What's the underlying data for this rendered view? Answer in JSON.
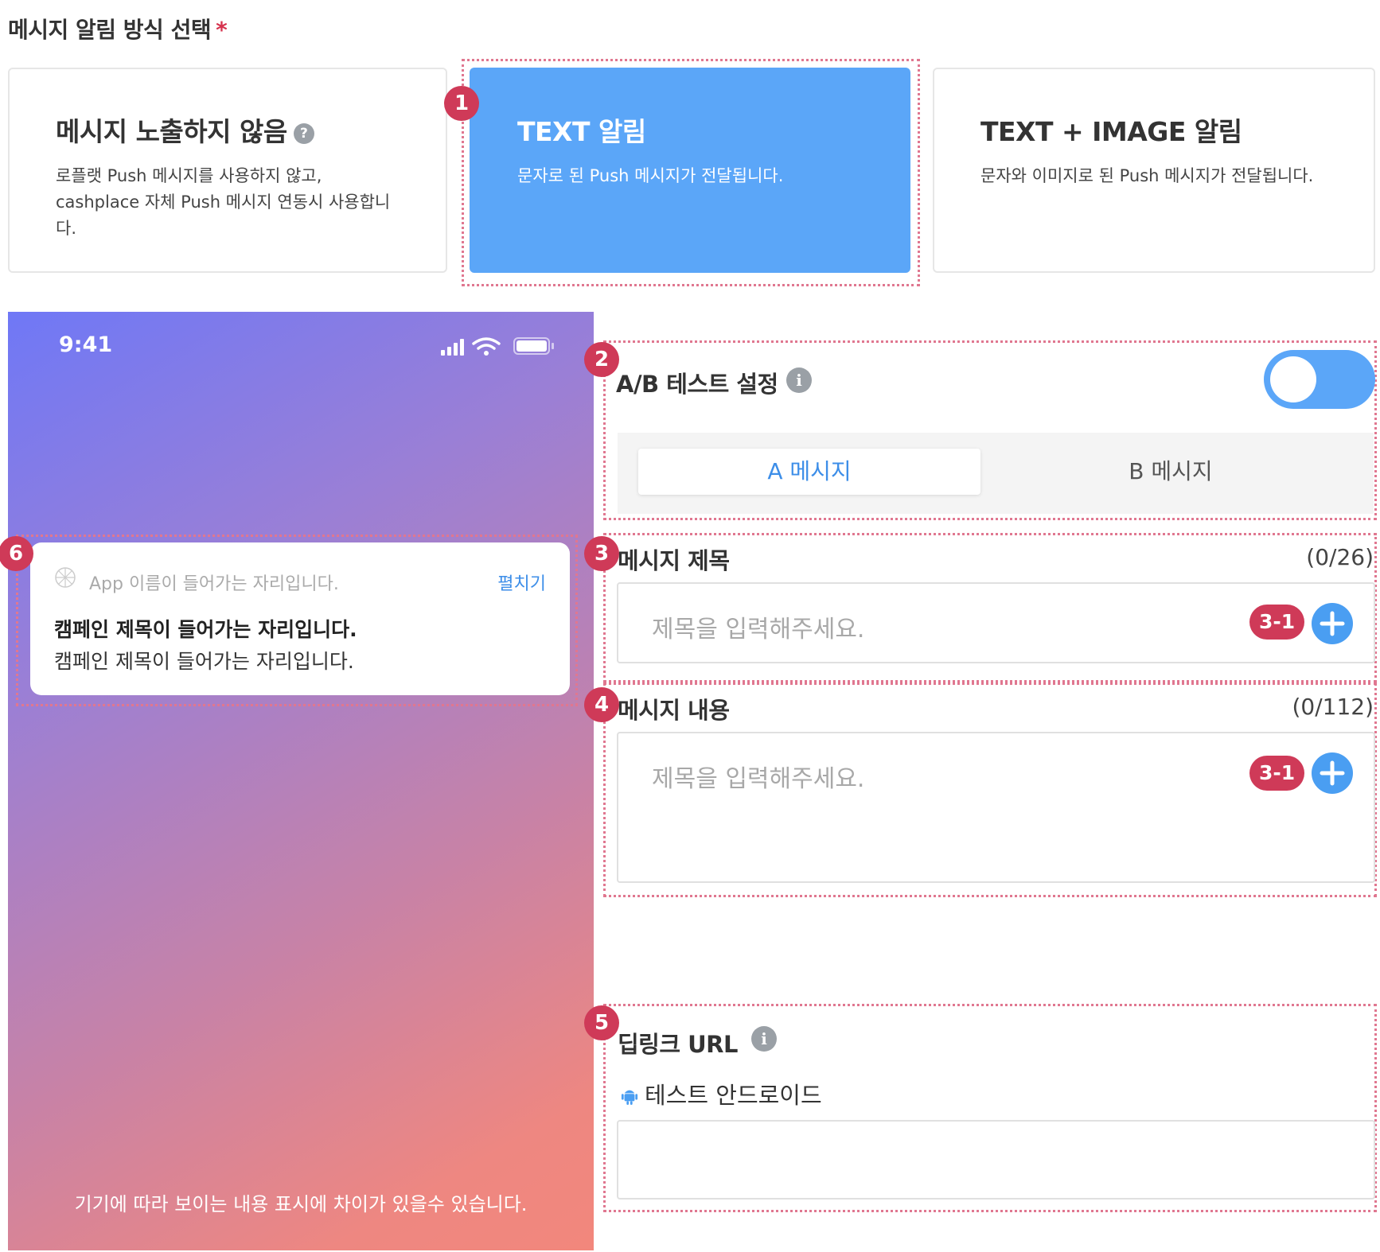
{
  "header": {
    "title": "메시지 알림 방식 선택",
    "required_mark": "*"
  },
  "cards": [
    {
      "title": "메시지 노출하지 않음",
      "help": "?",
      "desc": "로플랫 Push 메시지를 사용하지 않고, cashplace 자체 Push 메시지 연동시 사용합니다."
    },
    {
      "title": "TEXT 알림",
      "desc": "문자로 된 Push 메시지가 전달됩니다.",
      "selected": true
    },
    {
      "title": "TEXT + IMAGE 알림",
      "desc": "문자와 이미지로 된 Push 메시지가 전달됩니다."
    }
  ],
  "badges": {
    "b1": "1",
    "b2": "2",
    "b3": "3",
    "b4": "4",
    "b5": "5",
    "b6": "6",
    "b31": "3-1"
  },
  "phone": {
    "time": "9:41",
    "notification": {
      "app_name": "App 이름이 들어가는 자리입니다.",
      "expand": "펼치기",
      "title": "캠페인 제목이 들어가는 자리입니다.",
      "body": "캠페인 제목이 들어가는 자리입니다."
    },
    "footer": "기기에 따라 보이는 내용 표시에 차이가 있을수 있습니다."
  },
  "ab_test": {
    "label": "A/B 테스트 설정",
    "info": "i",
    "enabled": true,
    "tabs": [
      "A 메시지",
      "B 메시지"
    ]
  },
  "message_title": {
    "label": "메시지 제목",
    "counter": "(0/26)",
    "placeholder": "제목을 입력해주세요."
  },
  "message_body": {
    "label": "메시지 내용",
    "counter": "(0/112)",
    "placeholder": "제목을 입력해주세요."
  },
  "deeplink": {
    "label": "딥링크 URL",
    "info": "i",
    "platform_label": "테스트 안드로이드",
    "value": ""
  },
  "colors": {
    "accent": "#5ba6f8",
    "badge": "#cf3a58",
    "highlight_border": "#e07790"
  }
}
